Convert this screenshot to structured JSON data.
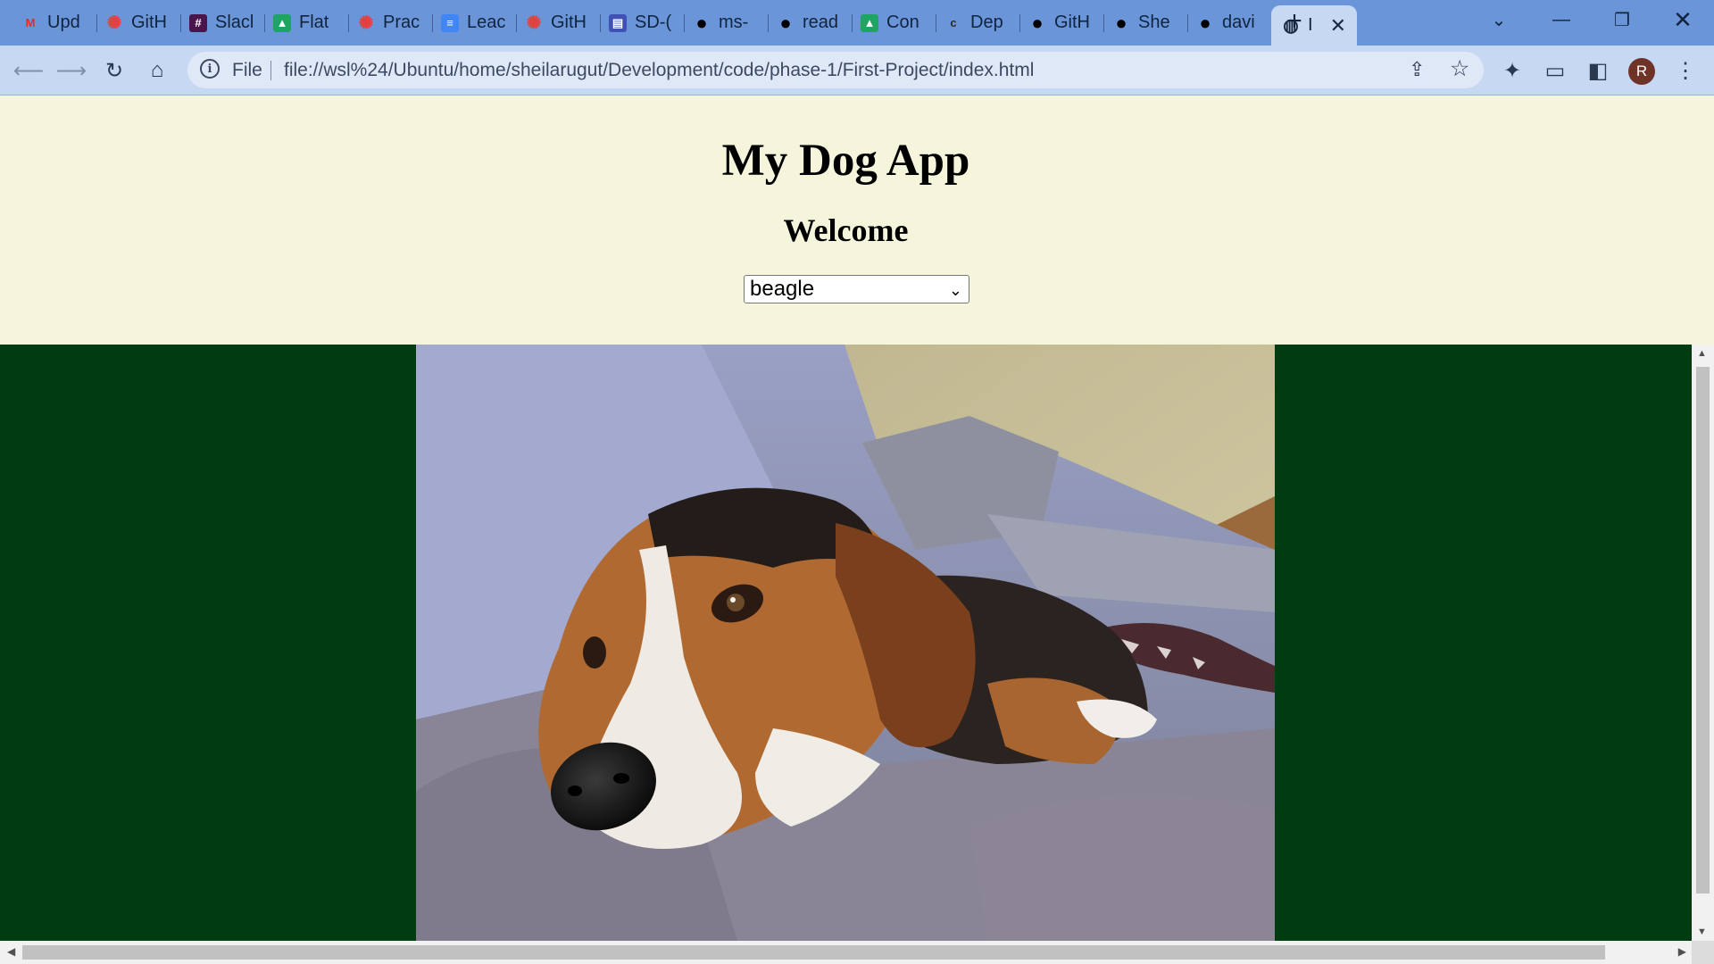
{
  "browser": {
    "tabs": [
      {
        "title": "Upd",
        "icon": "gmail-icon",
        "color": "#d93025"
      },
      {
        "title": "GitH",
        "icon": "learn-co-icon",
        "color": "#e3413f"
      },
      {
        "title": "Slacl",
        "icon": "slack-icon",
        "color": "#4a154b"
      },
      {
        "title": "Flat",
        "icon": "google-drive-icon",
        "color": "#1fa463"
      },
      {
        "title": "Prac",
        "icon": "learn-co-icon",
        "color": "#e3413f"
      },
      {
        "title": "Leac",
        "icon": "google-docs-icon",
        "color": "#4285f4"
      },
      {
        "title": "GitH",
        "icon": "learn-co-icon",
        "color": "#e3413f"
      },
      {
        "title": "SD-(",
        "icon": "forms-icon",
        "color": "#3f51b5"
      },
      {
        "title": "ms-",
        "icon": "github-icon",
        "color": "#000000"
      },
      {
        "title": "read",
        "icon": "github-icon",
        "color": "#000000"
      },
      {
        "title": "Con",
        "icon": "google-drive-icon",
        "color": "#1fa463"
      },
      {
        "title": "Dep",
        "icon": "canvas-icon",
        "color": "#2b2b2b"
      },
      {
        "title": "GitH",
        "icon": "github-icon",
        "color": "#000000"
      },
      {
        "title": "She",
        "icon": "github-icon",
        "color": "#000000"
      },
      {
        "title": "davi",
        "icon": "github-icon",
        "color": "#000000"
      }
    ],
    "active_tab": {
      "title": "I",
      "icon": "globe-icon"
    },
    "new_tab": "+",
    "address": {
      "scheme": "File",
      "url": "file://wsl%24/Ubuntu/home/sheilarugut/Development/code/phase-1/First-Project/index.html"
    },
    "profile_initial": "R"
  },
  "page": {
    "title": "My Dog App",
    "subtitle": "Welcome",
    "breed_select": {
      "selected": "beagle"
    },
    "colors": {
      "header_bg": "#f5f5dc",
      "section_bg": "#003b11"
    }
  }
}
